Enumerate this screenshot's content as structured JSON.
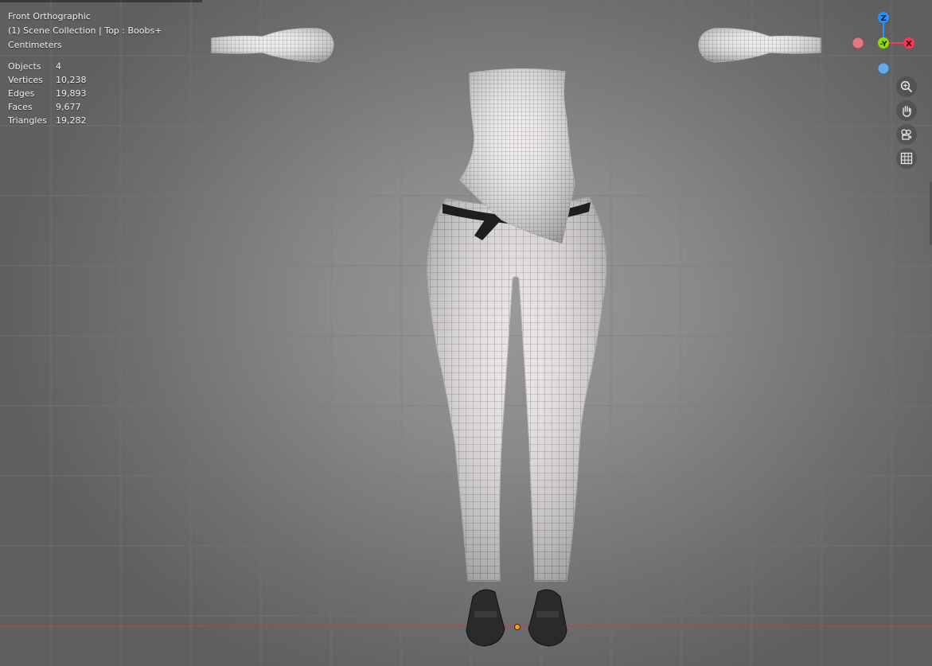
{
  "viewport": {
    "view_name": "Front Orthographic",
    "collection_line": "(1) Scene Collection | Top : Boobs+",
    "units": "Centimeters"
  },
  "stats": [
    {
      "label": "Objects",
      "value": "4"
    },
    {
      "label": "Vertices",
      "value": "10,238"
    },
    {
      "label": "Edges",
      "value": "19,893"
    },
    {
      "label": "Faces",
      "value": "9,677"
    },
    {
      "label": "Triangles",
      "value": "19,282"
    }
  ],
  "gizmo": {
    "z_label": "Z",
    "y_label": "-Y",
    "x_label": "X",
    "colors": {
      "x": "#ff3352",
      "y": "#8bdc00",
      "z": "#2890ff"
    }
  },
  "nav_icons": [
    "zoom-icon",
    "hand-pan-icon",
    "camera-view-icon",
    "grid-ortho-icon"
  ],
  "colors": {
    "axis_line": "#c0403e",
    "origin": "#ff9c1a"
  }
}
